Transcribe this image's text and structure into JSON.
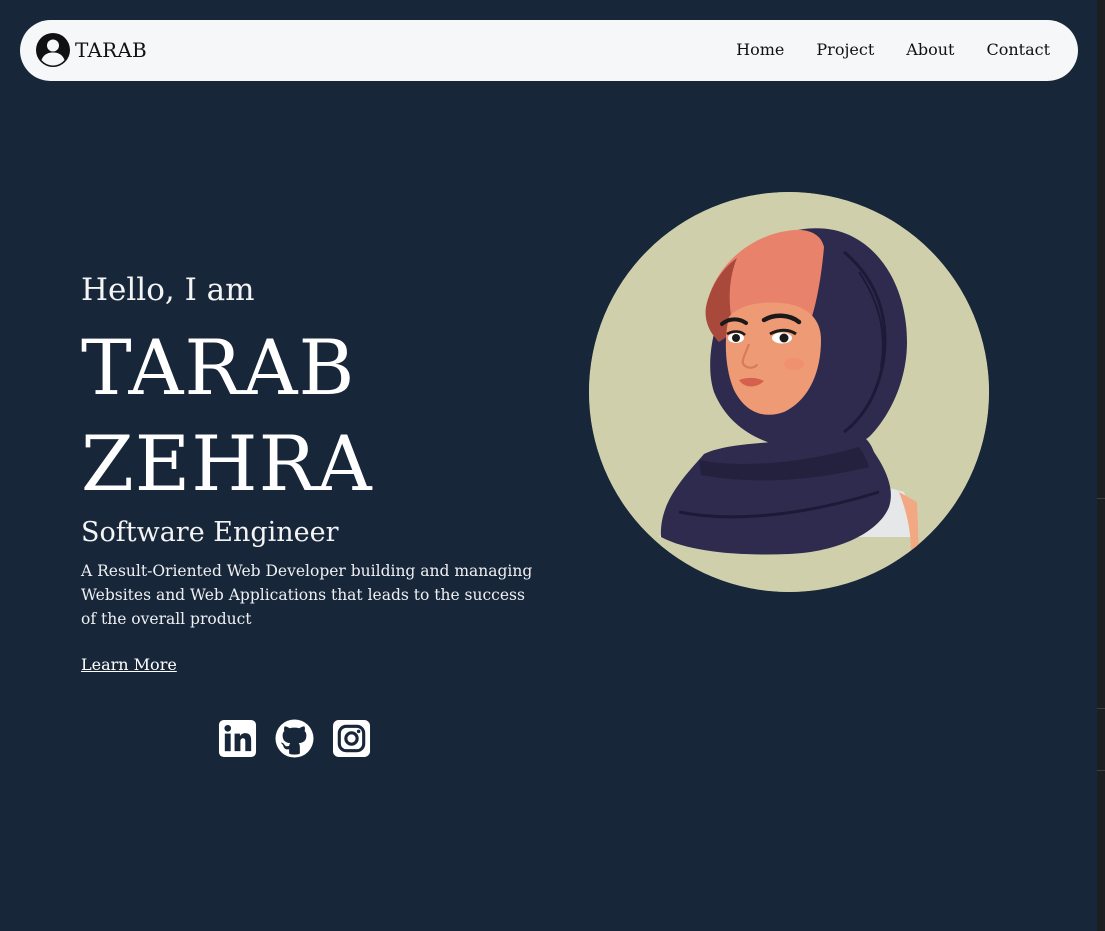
{
  "nav": {
    "brand": "TARAB",
    "brand_icon": "user-circle-icon",
    "links": [
      "Home",
      "Project",
      "About",
      "Contact"
    ]
  },
  "hero": {
    "greeting": "Hello, I am",
    "first_name": "TARAB",
    "last_name": "ZEHRA",
    "role": "Software Engineer",
    "description": "A Result-Oriented Web Developer building and managing Websites and Web Applications that leads to the success of the overall product",
    "cta": "Learn More"
  },
  "socials": [
    "linkedin-icon",
    "github-icon",
    "instagram-icon"
  ],
  "colors": {
    "background": "#18263a",
    "navbar": "#f6f7f9",
    "avatar_bg": "#cfd0ab",
    "hijab": "#2e2b4f",
    "skin": "#ee9a74",
    "headscarf_inner": "#e8826a"
  }
}
